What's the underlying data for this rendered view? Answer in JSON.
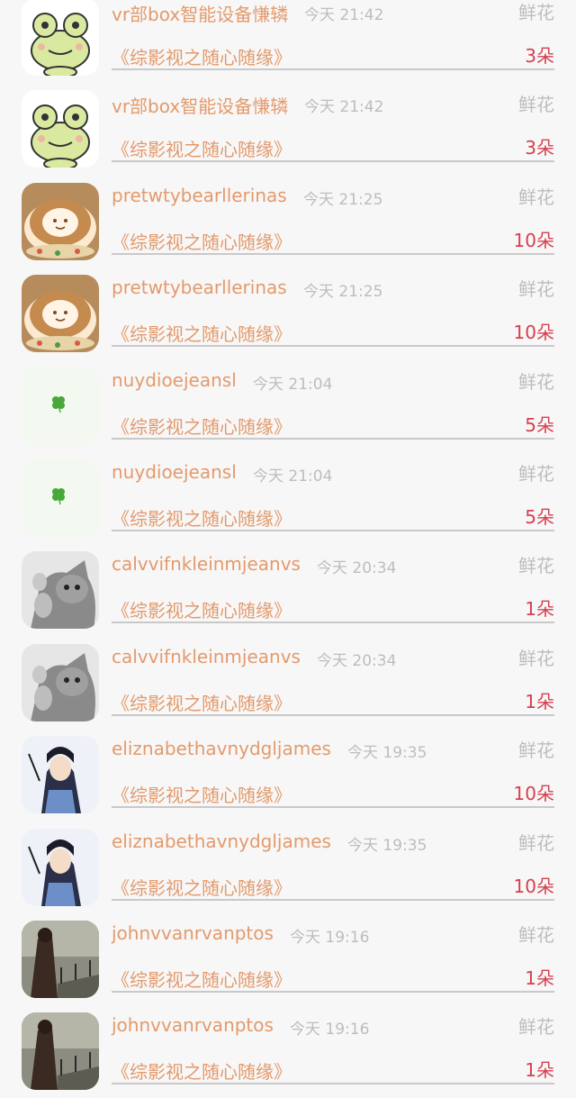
{
  "records": [
    {
      "name": "vr部box智能设备慊辚",
      "time": "今天 21:42",
      "type": "鲜花",
      "book": "《综影视之随心随缘》",
      "count": "3朵",
      "avatar": "frog"
    },
    {
      "name": "vr部box智能设备慊辚",
      "time": "今天 21:42",
      "type": "鲜花",
      "book": "《综影视之随心随缘》",
      "count": "3朵",
      "avatar": "frog"
    },
    {
      "name": "pretwtybearllerinas",
      "time": "今天 21:25",
      "type": "鲜花",
      "book": "《综影视之随心随缘》",
      "count": "10朵",
      "avatar": "latte"
    },
    {
      "name": "pretwtybearllerinas",
      "time": "今天 21:25",
      "type": "鲜花",
      "book": "《综影视之随心随缘》",
      "count": "10朵",
      "avatar": "latte"
    },
    {
      "name": "nuydioejeansl",
      "time": "今天 21:04",
      "type": "鲜花",
      "book": "《综影视之随心随缘》",
      "count": "5朵",
      "avatar": "clover"
    },
    {
      "name": "nuydioejeansl",
      "time": "今天 21:04",
      "type": "鲜花",
      "book": "《综影视之随心随缘》",
      "count": "5朵",
      "avatar": "clover"
    },
    {
      "name": "calvvifnkleinmjeanvs",
      "time": "今天 20:34",
      "type": "鲜花",
      "book": "《综影视之随心随缘》",
      "count": "1朵",
      "avatar": "cat"
    },
    {
      "name": "calvvifnkleinmjeanvs",
      "time": "今天 20:34",
      "type": "鲜花",
      "book": "《综影视之随心随缘》",
      "count": "1朵",
      "avatar": "cat"
    },
    {
      "name": "eliznabethavnydgljames",
      "time": "今天 19:35",
      "type": "鲜花",
      "book": "《综影视之随心随缘》",
      "count": "10朵",
      "avatar": "anime"
    },
    {
      "name": "eliznabethavnydgljames",
      "time": "今天 19:35",
      "type": "鲜花",
      "book": "《综影视之随心随缘》",
      "count": "10朵",
      "avatar": "anime"
    },
    {
      "name": "johnvvanrvanptos",
      "time": "今天 19:16",
      "type": "鲜花",
      "book": "《综影视之随心随缘》",
      "count": "1朵",
      "avatar": "photo"
    },
    {
      "name": "johnvvanrvanptos",
      "time": "今天 19:16",
      "type": "鲜花",
      "book": "《综影视之随心随缘》",
      "count": "1朵",
      "avatar": "photo"
    }
  ]
}
